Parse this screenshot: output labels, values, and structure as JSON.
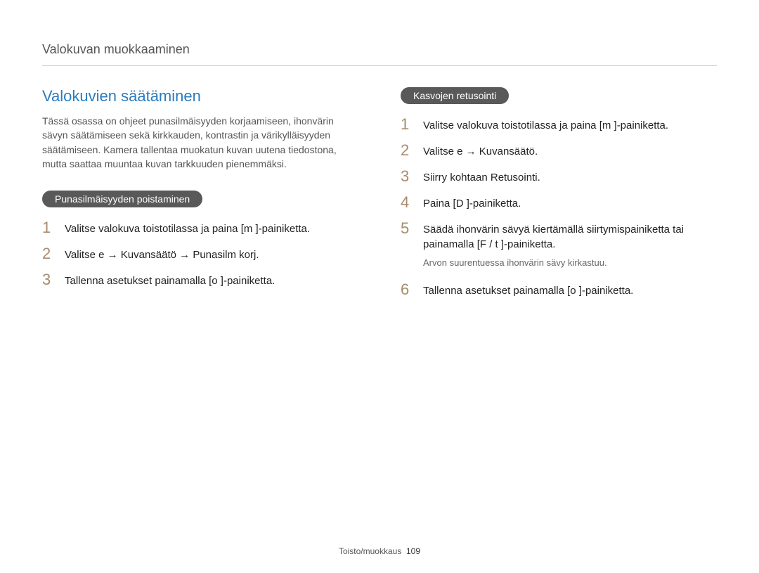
{
  "header": "Valokuvan muokkaaminen",
  "left": {
    "title": "Valokuvien säätäminen",
    "intro": "Tässä osassa on ohjeet punasilmäisyyden korjaamiseen, ihonvärin sävyn säätämiseen sekä kirkkauden, kontrastin ja värikylläisyyden säätämiseen. Kamera tallentaa muokatun kuvan uutena tiedostona, mutta saattaa muuntaa kuvan tarkkuuden pienemmäksi.",
    "pill": "Punasilmäisyyden poistaminen",
    "steps": [
      "Valitse valokuva toistotilassa ja paina [m     ]-painiketta.",
      "Valitse e    → Kuvansäätö → Punasilm korj.",
      "Tallenna asetukset painamalla [o    ]-painiketta."
    ]
  },
  "right": {
    "pill": "Kasvojen retusointi",
    "steps": [
      "Valitse valokuva toistotilassa ja paina [m     ]-painiketta.",
      "Valitse e    → Kuvansäätö.",
      "Siirry kohtaan Retusointi.",
      "Paina [D     ]-painiketta.",
      "Säädä ihonvärin sävyä kiertämällä siirtymispainiketta tai painamalla [F / t    ]-painiketta.",
      "Tallenna asetukset painamalla [o    ]-painiketta."
    ],
    "note": "Arvon suurentuessa ihonvärin sävy kirkastuu."
  },
  "footer": {
    "section": "Toisto/muokkaus",
    "page": "109"
  }
}
